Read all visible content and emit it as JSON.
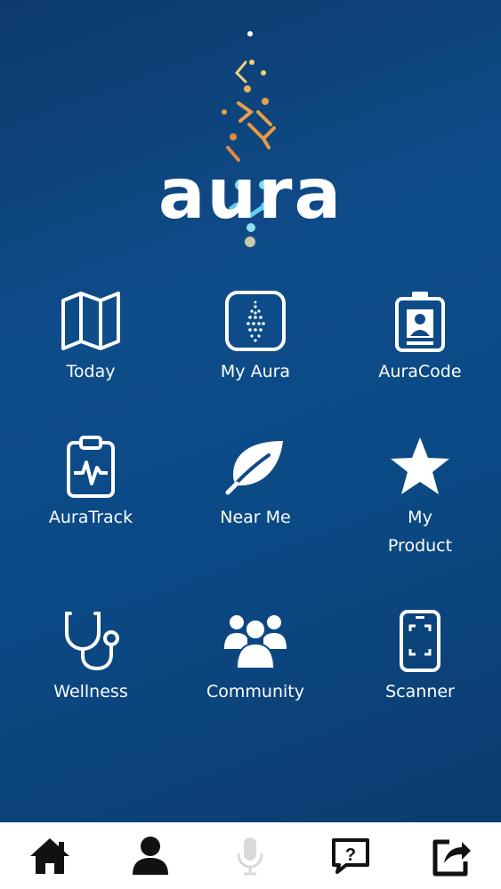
{
  "app": {
    "logo_text": "aura"
  },
  "tiles": [
    {
      "label": "Today",
      "icon": "map-icon"
    },
    {
      "label": "My Aura",
      "icon": "aura-square-icon"
    },
    {
      "label": "AuraCode",
      "icon": "id-badge-icon"
    },
    {
      "label": "AuraTrack",
      "icon": "clipboard-pulse-icon"
    },
    {
      "label": "Near Me",
      "icon": "leaf-icon"
    },
    {
      "label": "My\nProduct",
      "icon": "star-icon"
    },
    {
      "label": "Wellness",
      "icon": "stethoscope-icon"
    },
    {
      "label": "Community",
      "icon": "group-icon"
    },
    {
      "label": "Scanner",
      "icon": "phone-scan-icon"
    }
  ],
  "bottom_nav": [
    {
      "icon": "home-icon",
      "active": true
    },
    {
      "icon": "user-icon",
      "active": true
    },
    {
      "icon": "microphone-icon",
      "active": false
    },
    {
      "icon": "question-chat-icon",
      "active": true
    },
    {
      "icon": "share-icon",
      "active": true
    }
  ],
  "colors": {
    "background_top": "#0d3a6c",
    "background_mid": "#0f4c8a",
    "icon": "#ffffff",
    "nav_bg": "#ffffff",
    "nav_icon": "#111111",
    "nav_icon_disabled": "#d9d9d9",
    "logo_orange": "#e8a04a",
    "logo_cyan": "#5fd0ec"
  }
}
